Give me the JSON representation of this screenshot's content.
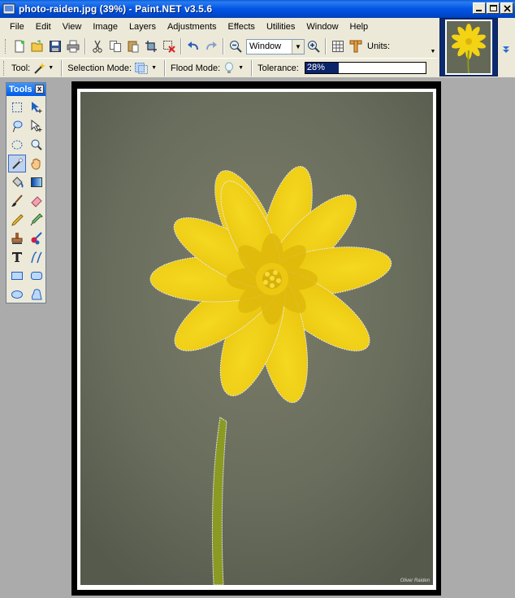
{
  "window": {
    "title": "photo-raiden.jpg (39%) - Paint.NET v3.5.6",
    "buttons": [
      "minimize-icon",
      "maximize-icon",
      "close-icon"
    ]
  },
  "menu": [
    "File",
    "Edit",
    "View",
    "Image",
    "Layers",
    "Adjustments",
    "Effects",
    "Utilities",
    "Window",
    "Help"
  ],
  "toolbar": {
    "zoom_value": "Window",
    "units_label": "Units:",
    "icons": [
      "new-document-icon",
      "open-icon",
      "save-icon",
      "print-icon",
      "cut-icon",
      "copy-icon",
      "paste-icon",
      "crop-icon",
      "deselect-icon",
      "undo-icon",
      "redo-icon",
      "zoom-out-icon",
      "zoom-in-icon",
      "grid-icon",
      "ruler-icon"
    ]
  },
  "tool_options": {
    "tool_label": "Tool:",
    "selection_mode_label": "Selection Mode:",
    "flood_mode_label": "Flood Mode:",
    "tolerance_label": "Tolerance:",
    "tolerance_value": "28%",
    "tolerance_fraction": 0.28
  },
  "tools_window": {
    "title": "Tools",
    "close": "x",
    "active_tool": "magic-wand",
    "tools": [
      "rectangle-select",
      "move-selected-pixels",
      "lasso-select",
      "move-selection",
      "ellipse-select",
      "zoom",
      "magic-wand",
      "pan",
      "paint-bucket",
      "gradient",
      "paintbrush",
      "eraser",
      "pencil",
      "color-picker",
      "clone-stamp",
      "recolor",
      "text",
      "line-curve",
      "rectangle",
      "rounded-rectangle",
      "ellipse",
      "freeform-shape"
    ]
  },
  "canvas": {
    "signature": "Oliver Raiden",
    "colors": {
      "petal": "#f3d313",
      "petal_dark": "#d9b80a",
      "center": "#e8c40a",
      "stem": "#8a9a1e",
      "background": "#676a5a"
    }
  }
}
